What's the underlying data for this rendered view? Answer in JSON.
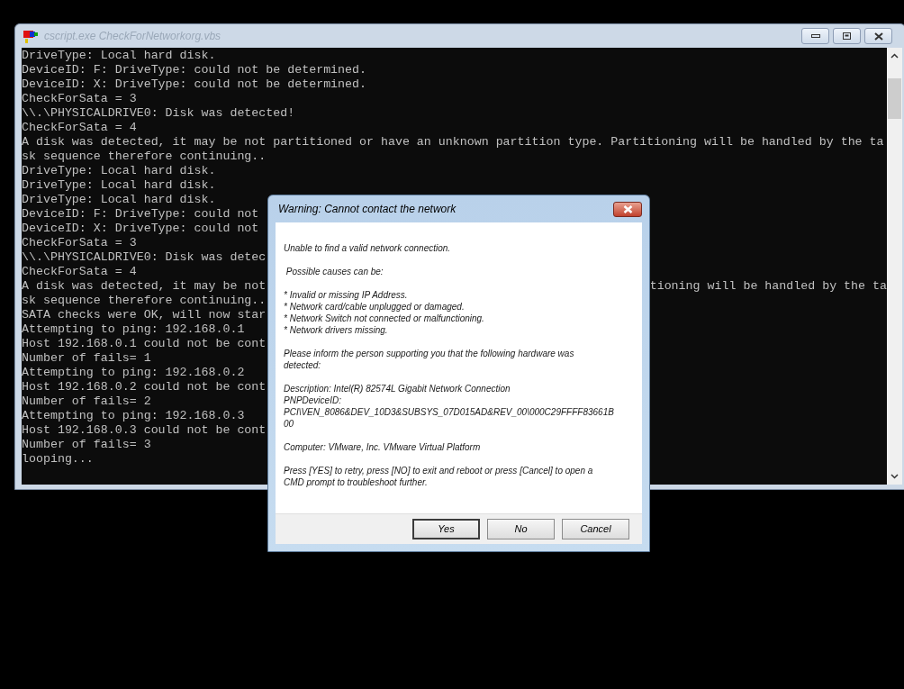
{
  "console_window": {
    "title": "cscript.exe CheckForNetworkorg.vbs",
    "lines": [
      {
        "text": "DriveType: Local hard disk."
      },
      {
        "text": "DeviceID: F: DriveType: could not be determined."
      },
      {
        "text": "DeviceID: X: DriveType: could not be determined."
      },
      {
        "text": "CheckForSata = 3"
      },
      {
        "text": "\\\\.\\PHYSICALDRIVE0: Disk was detected!"
      },
      {
        "text": "CheckForSata = 4"
      },
      {
        "text": "A disk was detected, it may be not partitioned or have an unknown partition type. Partitioning will be handled by the ta"
      },
      {
        "text": "sk sequence therefore continuing.."
      },
      {
        "text": "DriveType: Local hard disk."
      },
      {
        "text": "DriveType: Local hard disk."
      },
      {
        "text": "DriveType: Local hard disk."
      },
      {
        "text": "DeviceID: F: DriveType: could not"
      },
      {
        "text": "DeviceID: X: DriveType: could not"
      },
      {
        "text": "CheckForSata = 3"
      },
      {
        "text": "\\\\.\\PHYSICALDRIVE0: Disk was detec"
      },
      {
        "text": "CheckForSata = 4"
      },
      {
        "text": "A disk was detected, it may be not",
        "text_right": "tioning will be handled by the ta"
      },
      {
        "text": "sk sequence therefore continuing.."
      },
      {
        "text": "SATA checks were OK, will now star"
      },
      {
        "text": "Attempting to ping: 192.168.0.1"
      },
      {
        "text": "Host 192.168.0.1 could not be cont"
      },
      {
        "text": "Number of fails= 1"
      },
      {
        "text": "Attempting to ping: 192.168.0.2"
      },
      {
        "text": "Host 192.168.0.2 could not be cont"
      },
      {
        "text": "Number of fails= 2"
      },
      {
        "text": "Attempting to ping: 192.168.0.3"
      },
      {
        "text": "Host 192.168.0.3 could not be cont"
      },
      {
        "text": "Number of fails= 3"
      },
      {
        "text": "looping..."
      }
    ]
  },
  "dialog": {
    "title": "Warning: Cannot contact the network",
    "paragraphs": [
      [
        "Unable to find a valid network connection."
      ],
      [
        " Possible causes can be:"
      ],
      [
        "* Invalid or missing IP Address.",
        "* Network card/cable unplugged or damaged.",
        "* Network Switch not connected or malfunctioning.",
        "* Network drivers missing."
      ],
      [
        "Please inform the person supporting you that the following hardware was",
        "detected:"
      ],
      [
        "Description: Intel(R) 82574L Gigabit Network Connection",
        "PNPDeviceID:",
        "PCI\\VEN_8086&DEV_10D3&SUBSYS_07D015AD&REV_00\\000C29FFFF83661B",
        "00"
      ],
      [
        "Computer: VMware, Inc. VMware Virtual Platform"
      ],
      [
        "Press [YES] to retry, press [NO] to exit and reboot or press [Cancel] to open a",
        "CMD prompt to troubleshoot further."
      ]
    ],
    "buttons": [
      {
        "label": "Yes",
        "default": true
      },
      {
        "label": "No",
        "default": false
      },
      {
        "label": "Cancel",
        "default": false
      }
    ]
  }
}
